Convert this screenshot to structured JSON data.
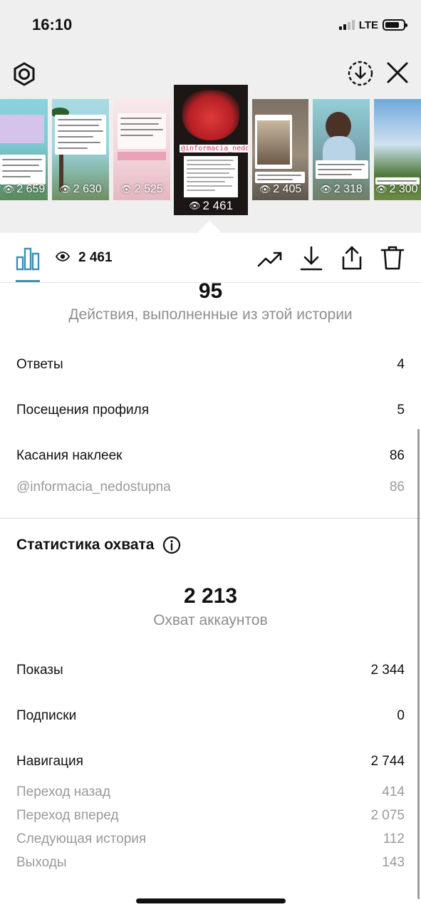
{
  "status_bar": {
    "time": "16:10",
    "network": "LTE"
  },
  "header": {
    "settings_icon": "gear-icon",
    "download_icon": "download-circle-icon",
    "close_icon": "close-icon"
  },
  "thumbnails": [
    {
      "views": "2 659"
    },
    {
      "views": "2 630"
    },
    {
      "views": "2 525"
    },
    {
      "views": "2 461",
      "caption": "@informacia_nedostupna",
      "selected": true
    },
    {
      "views": "2 405"
    },
    {
      "views": "2 318"
    },
    {
      "views": "2 300"
    }
  ],
  "action_bar": {
    "views_count": "2 461",
    "icons": [
      "bar-chart-icon",
      "eye-icon",
      "trend-icon",
      "download-icon",
      "share-icon",
      "trash-icon"
    ]
  },
  "interactions": {
    "total": "95",
    "label": "Действия, выполненные из этой истории",
    "rows": [
      {
        "label": "Ответы",
        "value": "4"
      },
      {
        "label": "Посещения профиля",
        "value": "5"
      },
      {
        "label": "Касания наклеек",
        "value": "86"
      }
    ],
    "sub_rows": [
      {
        "label": "@informacia_nedostupna",
        "value": "86"
      }
    ]
  },
  "reach": {
    "title": "Статистика охвата",
    "total": "2 213",
    "label": "Охват аккаунтов",
    "rows": [
      {
        "label": "Показы",
        "value": "2 344"
      },
      {
        "label": "Подписки",
        "value": "0"
      },
      {
        "label": "Навигация",
        "value": "2 744"
      }
    ],
    "sub_rows": [
      {
        "label": "Переход назад",
        "value": "414"
      },
      {
        "label": "Переход вперед",
        "value": "2 075"
      },
      {
        "label": "Следующая история",
        "value": "112"
      },
      {
        "label": "Выходы",
        "value": "143"
      }
    ]
  }
}
